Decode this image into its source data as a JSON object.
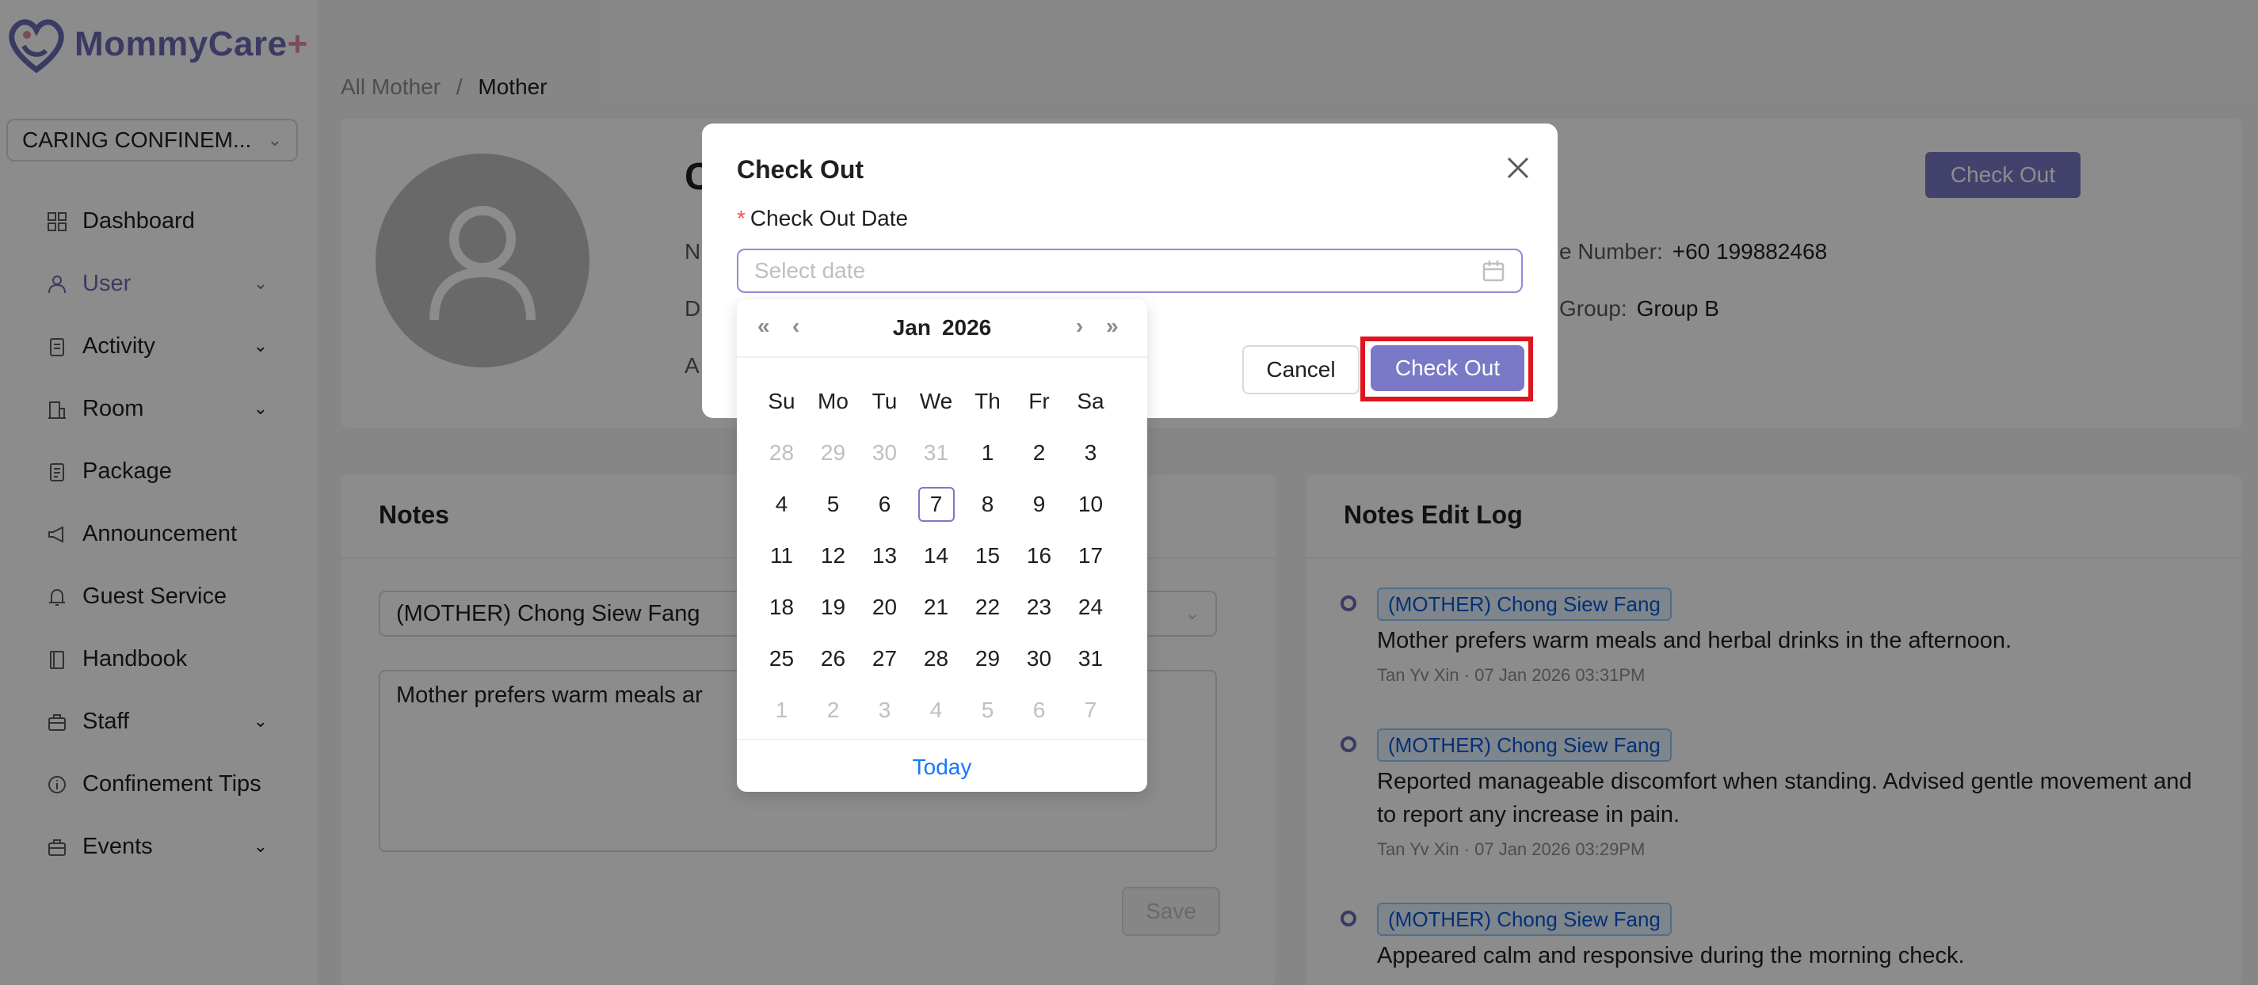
{
  "app": {
    "brand_name": "MommyCare",
    "brand_plus": "+",
    "org_select": "CARING CONFINEM...",
    "menu": [
      {
        "label": "Dashboard",
        "icon": "dashboard-icon",
        "has_children": false
      },
      {
        "label": "User",
        "icon": "user-icon",
        "has_children": true,
        "active": true
      },
      {
        "label": "Activity",
        "icon": "activity-icon",
        "has_children": true
      },
      {
        "label": "Room",
        "icon": "room-icon",
        "has_children": true
      },
      {
        "label": "Package",
        "icon": "package-icon",
        "has_children": false
      },
      {
        "label": "Announcement",
        "icon": "announcement-icon",
        "has_children": false
      },
      {
        "label": "Guest Service",
        "icon": "bell-icon",
        "has_children": false
      },
      {
        "label": "Handbook",
        "icon": "book-icon",
        "has_children": false
      },
      {
        "label": "Staff",
        "icon": "staff-icon",
        "has_children": true
      },
      {
        "label": "Confinement Tips",
        "icon": "info-icon",
        "has_children": false
      },
      {
        "label": "Events",
        "icon": "events-icon",
        "has_children": true
      }
    ]
  },
  "breadcrumb": {
    "parent": "All Mother",
    "separator": "/",
    "current": "Mother"
  },
  "profile": {
    "name_initial": "C",
    "label_n": "N",
    "label_d": "D",
    "label_a": "A",
    "phone_label": "e Number:",
    "phone_value": "+60 199882468",
    "group_label": "Group:",
    "group_value": "Group B",
    "checkout_button": "Check Out"
  },
  "notes": {
    "title": "Notes",
    "select_value": "(MOTHER) Chong Siew Fang",
    "text_value": "Mother prefers warm meals ar",
    "save_button": "Save"
  },
  "log": {
    "title": "Notes Edit Log",
    "entries": [
      {
        "tag": "(MOTHER) Chong Siew Fang",
        "text": "Mother prefers warm meals and herbal drinks in the afternoon.",
        "meta": "Tan Yv Xin · 07 Jan 2026 03:31PM"
      },
      {
        "tag": "(MOTHER) Chong Siew Fang",
        "text": "Reported manageable discomfort when standing. Advised gentle movement and to report any increase in pain.",
        "meta": "Tan Yv Xin · 07 Jan 2026 03:29PM"
      },
      {
        "tag": "(MOTHER) Chong Siew Fang",
        "text": "Appeared calm and responsive during the morning check.",
        "meta": ""
      }
    ]
  },
  "modal": {
    "title": "Check Out",
    "field_label": "Check Out Date",
    "date_placeholder": "Select date",
    "cancel_button": "Cancel",
    "ok_button": "Check Out"
  },
  "datepicker": {
    "month": "Jan",
    "year": "2026",
    "weekdays": [
      "Su",
      "Mo",
      "Tu",
      "We",
      "Th",
      "Fr",
      "Sa"
    ],
    "weeks": [
      [
        {
          "d": "28",
          "off": true
        },
        {
          "d": "29",
          "off": true
        },
        {
          "d": "30",
          "off": true
        },
        {
          "d": "31",
          "off": true
        },
        {
          "d": "1"
        },
        {
          "d": "2"
        },
        {
          "d": "3"
        }
      ],
      [
        {
          "d": "4"
        },
        {
          "d": "5"
        },
        {
          "d": "6"
        },
        {
          "d": "7",
          "today": true
        },
        {
          "d": "8"
        },
        {
          "d": "9"
        },
        {
          "d": "10"
        }
      ],
      [
        {
          "d": "11"
        },
        {
          "d": "12"
        },
        {
          "d": "13"
        },
        {
          "d": "14"
        },
        {
          "d": "15"
        },
        {
          "d": "16"
        },
        {
          "d": "17"
        }
      ],
      [
        {
          "d": "18"
        },
        {
          "d": "19"
        },
        {
          "d": "20"
        },
        {
          "d": "21"
        },
        {
          "d": "22"
        },
        {
          "d": "23"
        },
        {
          "d": "24"
        }
      ],
      [
        {
          "d": "25"
        },
        {
          "d": "26"
        },
        {
          "d": "27"
        },
        {
          "d": "28"
        },
        {
          "d": "29"
        },
        {
          "d": "30"
        },
        {
          "d": "31"
        }
      ],
      [
        {
          "d": "1",
          "off": true
        },
        {
          "d": "2",
          "off": true
        },
        {
          "d": "3",
          "off": true
        },
        {
          "d": "4",
          "off": true
        },
        {
          "d": "5",
          "off": true
        },
        {
          "d": "6",
          "off": true
        },
        {
          "d": "7",
          "off": true
        }
      ]
    ],
    "today_link": "Today"
  },
  "colors": {
    "accent": "#7a79c7",
    "highlight": "#e0141e"
  }
}
